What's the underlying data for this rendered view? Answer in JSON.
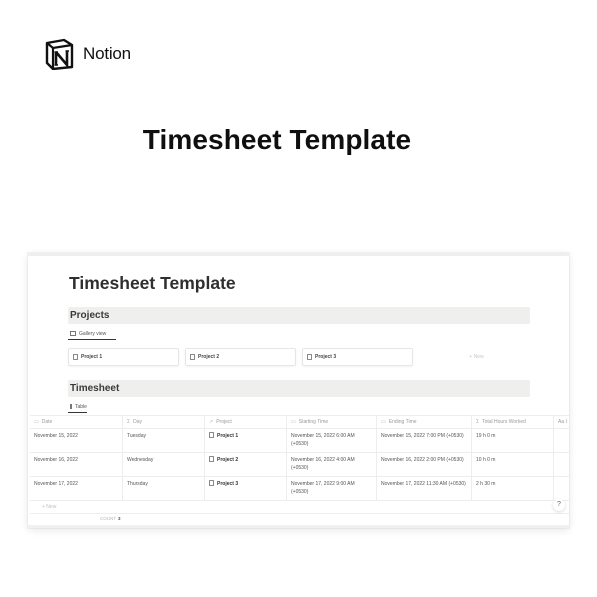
{
  "brand": {
    "name": "Notion",
    "logo_icon": "notion-logo-icon"
  },
  "hero": {
    "title": "Timesheet Template"
  },
  "screenshot": {
    "page_title": "Timesheet Template",
    "projects": {
      "heading": "Projects",
      "view_tab": {
        "label": "Gallery view",
        "icon": "gallery-icon"
      },
      "cards": [
        {
          "label": "Project 1",
          "icon": "page-icon"
        },
        {
          "label": "Project 2",
          "icon": "page-icon"
        },
        {
          "label": "Project 3",
          "icon": "page-icon"
        }
      ],
      "new_label": "+ New"
    },
    "timesheet": {
      "heading": "Timesheet",
      "view_tab": {
        "label": "Table",
        "icon": "table-icon"
      },
      "columns": [
        {
          "label": "Date",
          "icon": "calendar-icon"
        },
        {
          "label": "Day",
          "icon": "formula-icon"
        },
        {
          "label": "Project",
          "icon": "relation-icon"
        },
        {
          "label": "Starting Time",
          "icon": "calendar-icon"
        },
        {
          "label": "Ending Time",
          "icon": "calendar-icon"
        },
        {
          "label": "Total Hours Worked",
          "icon": "formula-icon"
        },
        {
          "label": "Aa I",
          "icon": ""
        }
      ],
      "rows": [
        {
          "date": "November 15, 2022",
          "day": "Tuesday",
          "project": "Project 1",
          "start": "November 15, 2022 6:00 AM (+0530)",
          "end": "November 15, 2022 7:00 PM (+0530)",
          "total": "19 h 0 m"
        },
        {
          "date": "November 16, 2022",
          "day": "Wednesday",
          "project": "Project 2",
          "start": "November 16, 2022 4:00 AM (+0530)",
          "end": "November 16, 2022 2:00 PM (+0530)",
          "total": "10 h 0 m"
        },
        {
          "date": "November 17, 2022",
          "day": "Thursday",
          "project": "Project 3",
          "start": "November 17, 2022 9:00 AM (+0530)",
          "end": "November 17, 2022 11:30 AM (+0530)",
          "total": "2 h 30 m"
        }
      ],
      "new_label": "+ New",
      "count_label": "COUNT",
      "count_value": "3"
    },
    "help_label": "?"
  }
}
